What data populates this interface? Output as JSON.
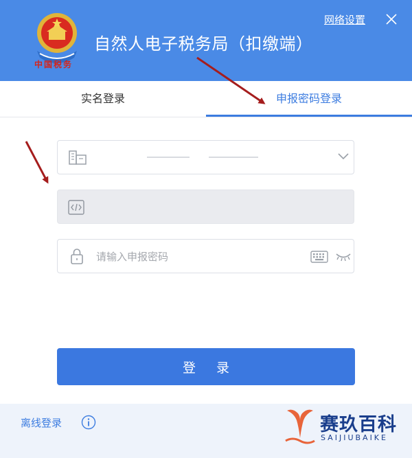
{
  "header": {
    "title": "自然人电子税务局（扣缴端）",
    "network_settings": "网络设置",
    "close_icon": "close-icon",
    "emblem_icon": "national-emblem-icon",
    "emblem_caption": "中国税务"
  },
  "tabs": [
    {
      "label": "实名登录",
      "active": false
    },
    {
      "label": "申报密码登录",
      "active": true
    }
  ],
  "form": {
    "account": {
      "icon": "building-icon",
      "value": "",
      "dropdown_icon": "chevron-down-icon"
    },
    "tax_code": {
      "icon": "code-icon",
      "value": "",
      "disabled": true
    },
    "password": {
      "icon": "lock-icon",
      "placeholder": "请输入申报密码",
      "value": "",
      "keyboard_icon": "keyboard-icon",
      "visibility_icon": "eye-closed-icon"
    }
  },
  "login_button": "登 录",
  "footer": {
    "offline_login": "离线登录",
    "info_icon": "info-icon"
  },
  "watermark": {
    "title": "赛玖百科",
    "subtitle": "SAIJIUBAIKE"
  },
  "colors": {
    "header_bg": "#4a8ae6",
    "accent": "#3b78e0",
    "footer_bg": "#eef3fb",
    "annotation_arrow": "#a51d1d"
  }
}
